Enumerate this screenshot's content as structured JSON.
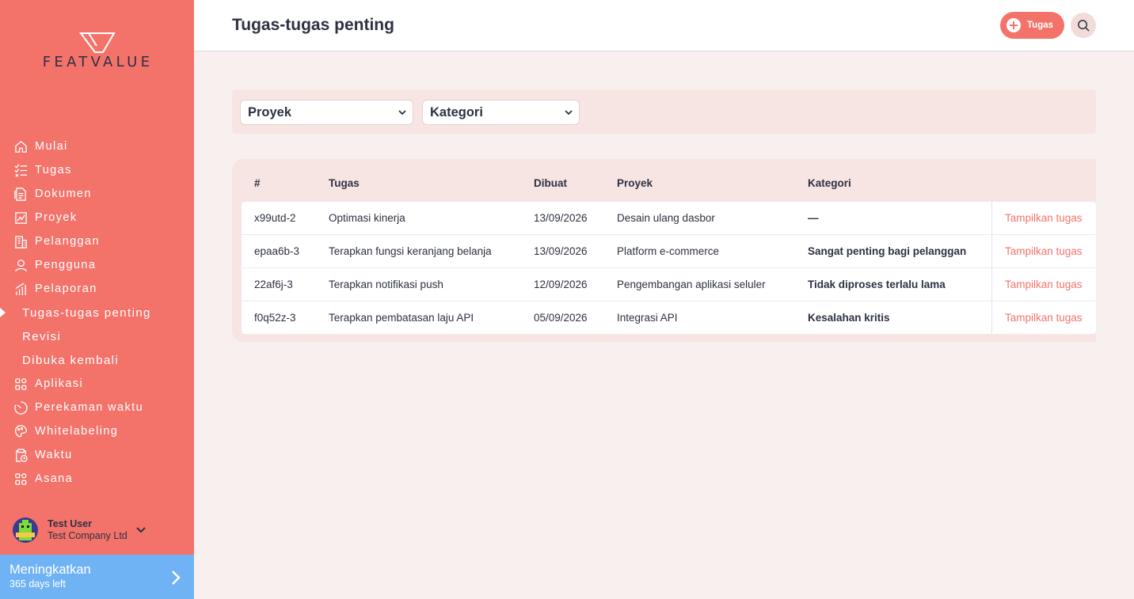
{
  "brand": {
    "name": "FEATVALUE"
  },
  "colors": {
    "accent": "#f3736b",
    "upgrade": "#6fb3f5",
    "text": "#2d3142"
  },
  "sidebar": {
    "items": [
      {
        "label": "Mulai",
        "icon": "home-icon"
      },
      {
        "label": "Tugas",
        "icon": "checklist-icon"
      },
      {
        "label": "Dokumen",
        "icon": "document-icon"
      },
      {
        "label": "Proyek",
        "icon": "chart-icon"
      },
      {
        "label": "Pelanggan",
        "icon": "building-icon"
      },
      {
        "label": "Pengguna",
        "icon": "user-icon"
      },
      {
        "label": "Pelaporan",
        "icon": "bar-chart-icon"
      }
    ],
    "subitems": [
      {
        "label": "Tugas-tugas penting",
        "active": true
      },
      {
        "label": "Revisi"
      },
      {
        "label": "Dibuka kembali"
      }
    ],
    "items2": [
      {
        "label": "Aplikasi",
        "icon": "apps-icon"
      },
      {
        "label": "Perekaman waktu",
        "icon": "timer-icon"
      },
      {
        "label": "Whitelabeling",
        "icon": "palette-icon"
      },
      {
        "label": "Waktu",
        "icon": "clipboard-clock-icon"
      },
      {
        "label": "Asana",
        "icon": "apps-icon"
      }
    ],
    "user": {
      "name": "Test User",
      "company": "Test Company Ltd"
    },
    "upgrade": {
      "title": "Meningkatkan",
      "subtitle": "365 days left"
    }
  },
  "header": {
    "title": "Tugas-tugas penting",
    "add_label": "Tugas"
  },
  "filters": {
    "proyek": "Proyek",
    "kategori": "Kategori"
  },
  "table": {
    "headers": {
      "id": "#",
      "task": "Tugas",
      "created": "Dibuat",
      "project": "Proyek",
      "category": "Kategori"
    },
    "rows": [
      {
        "id": "x99utd-2",
        "task": "Optimasi kinerja",
        "created": "13/09/2026",
        "project": "Desain ulang dasbor",
        "category": "—",
        "action": "Tampilkan tugas"
      },
      {
        "id": "epaa6b-3",
        "task": "Terapkan fungsi keranjang belanja",
        "created": "13/09/2026",
        "project": "Platform e-commerce",
        "category": "Sangat penting bagi pelanggan",
        "action": "Tampilkan tugas"
      },
      {
        "id": "22af6j-3",
        "task": "Terapkan notifikasi push",
        "created": "12/09/2026",
        "project": "Pengembangan aplikasi seluler",
        "category": "Tidak diproses terlalu lama",
        "action": "Tampilkan tugas"
      },
      {
        "id": "f0q52z-3",
        "task": "Terapkan pembatasan laju API",
        "created": "05/09/2026",
        "project": "Integrasi API",
        "category": "Kesalahan kritis",
        "action": "Tampilkan tugas"
      }
    ]
  }
}
